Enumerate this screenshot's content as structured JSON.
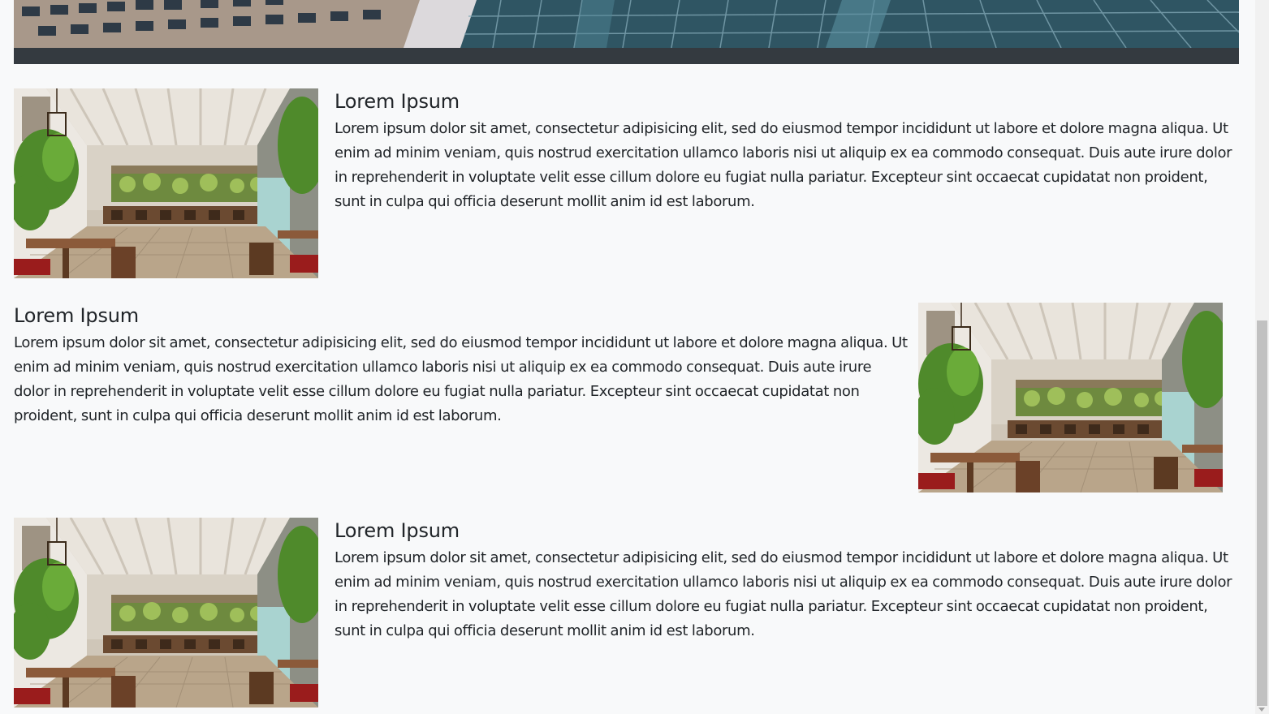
{
  "hero": {
    "image": "city-skyscrapers-image",
    "bar_color": "#343a40"
  },
  "features": [
    {
      "title": "Lorem Ipsum",
      "body": "Lorem ipsum dolor sit amet, consectetur adipisicing elit, sed do eiusmod tempor incididunt ut labore et dolore magna aliqua. Ut enim ad minim veniam, quis nostrud exercitation ullamco laboris nisi ut aliquip ex ea commodo consequat. Duis aute irure dolor in reprehenderit in voluptate velit esse cillum dolore eu fugiat nulla pariatur. Excepteur sint occaecat cupidatat non proident, sunt in culpa qui officia deserunt mollit anim id est laborum.",
      "image": "restaurant-interior-image",
      "image_side": "left"
    },
    {
      "title": "Lorem Ipsum",
      "body": "Lorem ipsum dolor sit amet, consectetur adipisicing elit, sed do eiusmod tempor incididunt ut labore et dolore magna aliqua. Ut enim ad minim veniam, quis nostrud exercitation ullamco laboris nisi ut aliquip ex ea commodo consequat. Duis aute irure dolor in reprehenderit in voluptate velit esse cillum dolore eu fugiat nulla pariatur. Excepteur sint occaecat cupidatat non proident, sunt in culpa qui officia deserunt mollit anim id est laborum.",
      "image": "restaurant-interior-image",
      "image_side": "right"
    },
    {
      "title": "Lorem Ipsum",
      "body": "Lorem ipsum dolor sit amet, consectetur adipisicing elit, sed do eiusmod tempor incididunt ut labore et dolore magna aliqua. Ut enim ad minim veniam, quis nostrud exercitation ullamco laboris nisi ut aliquip ex ea commodo consequat. Duis aute irure dolor in reprehenderit in voluptate velit esse cillum dolore eu fugiat nulla pariatur. Excepteur sint occaecat cupidatat non proident, sunt in culpa qui officia deserunt mollit anim id est laborum.",
      "image": "restaurant-interior-image",
      "image_side": "left"
    }
  ],
  "colors": {
    "page_background": "#f8f9fa",
    "text": "#212529"
  }
}
